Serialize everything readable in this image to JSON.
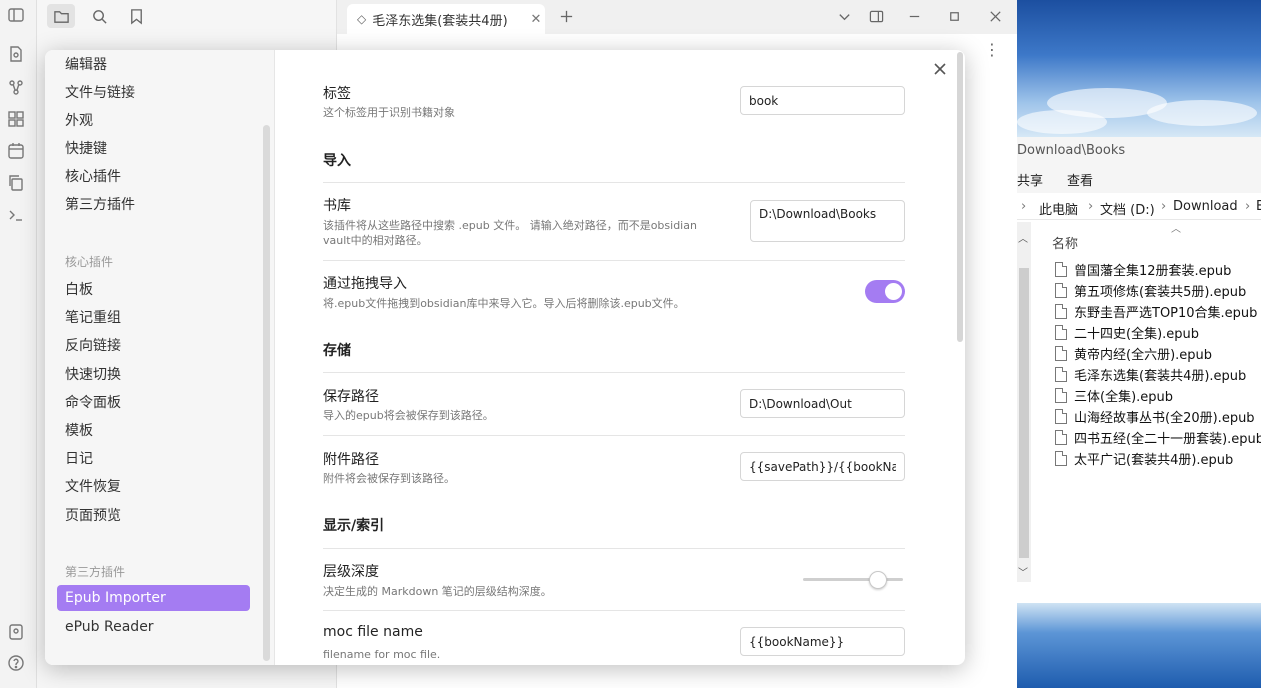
{
  "workspace": {
    "active_tab_title": "毛泽东选集(套装共4册)",
    "faint_header_text": "毛泽东选集(套装共4册)"
  },
  "settings_modal": {
    "nav_options": [
      "编辑器",
      "文件与链接",
      "外观",
      "快捷键",
      "核心插件",
      "第三方插件"
    ],
    "nav_core_group_label": "核心插件",
    "nav_core_plugins": [
      "白板",
      "笔记重组",
      "反向链接",
      "快速切换",
      "命令面板",
      "模板",
      "日记",
      "文件恢复",
      "页面预览"
    ],
    "nav_third_group_label": "第三方插件",
    "nav_third_plugins": [
      "Epub Importer",
      "ePub Reader"
    ],
    "active_nav_item": "Epub Importer",
    "accent_color": "#a47cf2",
    "content": {
      "tag": {
        "name": "标签",
        "desc": "这个标签用于识别书籍对象",
        "value": "book"
      },
      "import_heading": "导入",
      "library": {
        "name": "书库",
        "desc": "该插件将从这些路径中搜索 .epub 文件。 请输入绝对路径，而不是obsidian vault中的相对路径。",
        "value": "D:\\Download\\Books"
      },
      "drag_import": {
        "name": "通过拖拽导入",
        "desc": "将.epub文件拖拽到obsidian库中来导入它。导入后将删除该.epub文件。",
        "enabled": true
      },
      "storage_heading": "存储",
      "save_path": {
        "name": "保存路径",
        "desc": "导入的epub将会被保存到该路径。",
        "value": "D:\\Download\\Out"
      },
      "attachment_path": {
        "name": "附件路径",
        "desc": "附件将会被保存到该路径。",
        "value": "{{savePath}}/{{bookName}}"
      },
      "display_heading": "显示/索引",
      "level_depth": {
        "name": "层级深度",
        "desc": "决定生成的 Markdown 笔记的层级结构深度。",
        "slider_fraction": 0.75
      },
      "moc_file_name": {
        "name": "moc file name",
        "desc": "filename for moc file.",
        "value": "{{bookName}}"
      }
    }
  },
  "explorer": {
    "title_path": "Download\\Books",
    "menu": {
      "share": "共享",
      "view": "查看"
    },
    "breadcrumb": [
      "此电脑",
      "文档 (D:)",
      "Download",
      "B"
    ],
    "column_header": "名称",
    "files": [
      "曾国藩全集12册套装.epub",
      "第五项修炼(套装共5册).epub",
      "东野圭吾严选TOP10合集.epub",
      "二十四史(全集).epub",
      "黄帝内经(全六册).epub",
      "毛泽东选集(套装共4册).epub",
      "三体(全集).epub",
      "山海经故事丛书(全20册).epub",
      "四书五经(全二十一册套装).epub",
      "太平广记(套装共4册).epub"
    ]
  }
}
